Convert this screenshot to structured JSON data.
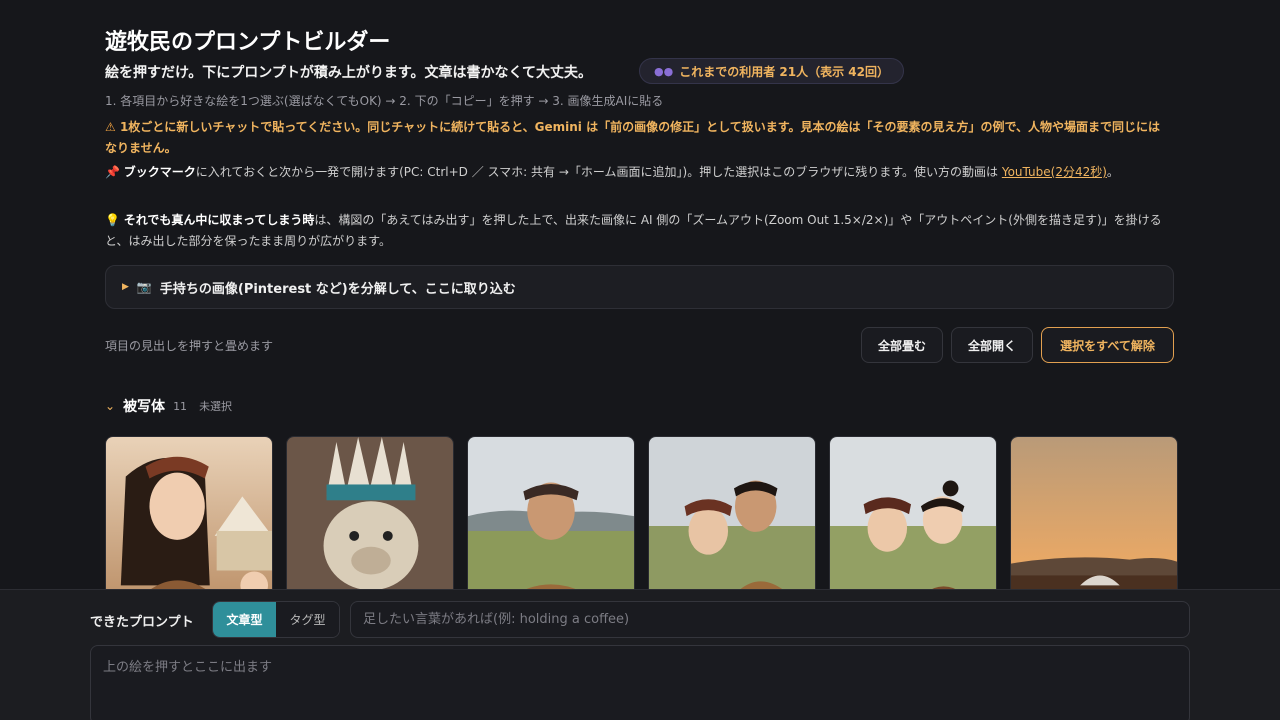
{
  "header": {
    "title": "遊牧民のプロンプトビルダー",
    "subtitle": "絵を押すだけ。下にプロンプトが積み上がります。文章は書かなくて大丈夫。",
    "usage_badge": "これまでの利用者 21人（表示 42回）",
    "steps": "1. 各項目から好きな絵を1つ選ぶ(選ばなくてもOK) → 2. 下の「コピー」を押す → 3. 画像生成AIに貼る"
  },
  "notes": {
    "warning": {
      "icon": "warning-icon",
      "pre": "1枚ごとに",
      "emph": "新しいチャット",
      "post": "で貼ってください。同じチャットに続けて貼ると、Gemini は「前の画像の修正」として扱います。見本の絵は「その要素の見え方」の例で、人物や場面まで同じにはなりません。"
    },
    "bookmark": {
      "icon": "pushpin-icon",
      "bold": "ブックマーク",
      "text": "に入れておくと次から一発で開けます(PC: Ctrl+D ／ スマホ: 共有 →「ホーム画面に追加」)。押した選択はこのブラウザに残ります。使い方の動画は",
      "link": "YouTube(2分42秒)",
      "after": "。"
    },
    "tip": {
      "icon": "lightbulb-icon",
      "bold": "それでも真ん中に収まってしまう時",
      "text": "は、構図の「あえてはみ出す」を押した上で、出来た画像に AI 側の「ズームアウト(Zoom Out 1.5×/2×)」や「アウトペイント(外側を描き足す)」を掛けると、はみ出した部分を保ったまま周りが広がります。"
    }
  },
  "import_panel": {
    "label": "手持ちの画像(Pinterest など)を分解して、ここに取り込む"
  },
  "controls": {
    "hint": "項目の見出しを押すと畳めます",
    "collapse_all": "全部畳む",
    "expand_all": "全部開く",
    "clear_all": "選択をすべて解除"
  },
  "section": {
    "name": "被写体",
    "count": "11",
    "state": "未選択",
    "images": [
      {
        "label": "woman-yurt",
        "icon": "portrait-image"
      },
      {
        "label": "seal-headdress",
        "icon": "animal-image"
      },
      {
        "label": "man-steppe",
        "icon": "portrait-image"
      },
      {
        "label": "couple-steppe",
        "icon": "portrait-image"
      },
      {
        "label": "two-women-steppe",
        "icon": "portrait-image"
      },
      {
        "label": "yurt-sunset",
        "icon": "landscape-image"
      }
    ]
  },
  "prompt_bar": {
    "label": "できたプロンプト",
    "mode_sentence": "文章型",
    "mode_tags": "タグ型",
    "extra_placeholder": "足したい言葉があれば(例: holding a coffee)",
    "output_placeholder": "上の絵を押すとここに出ます"
  },
  "colors": {
    "background": "#16171b",
    "accent": "#f0b45f",
    "teal": "#2f8f9a"
  }
}
